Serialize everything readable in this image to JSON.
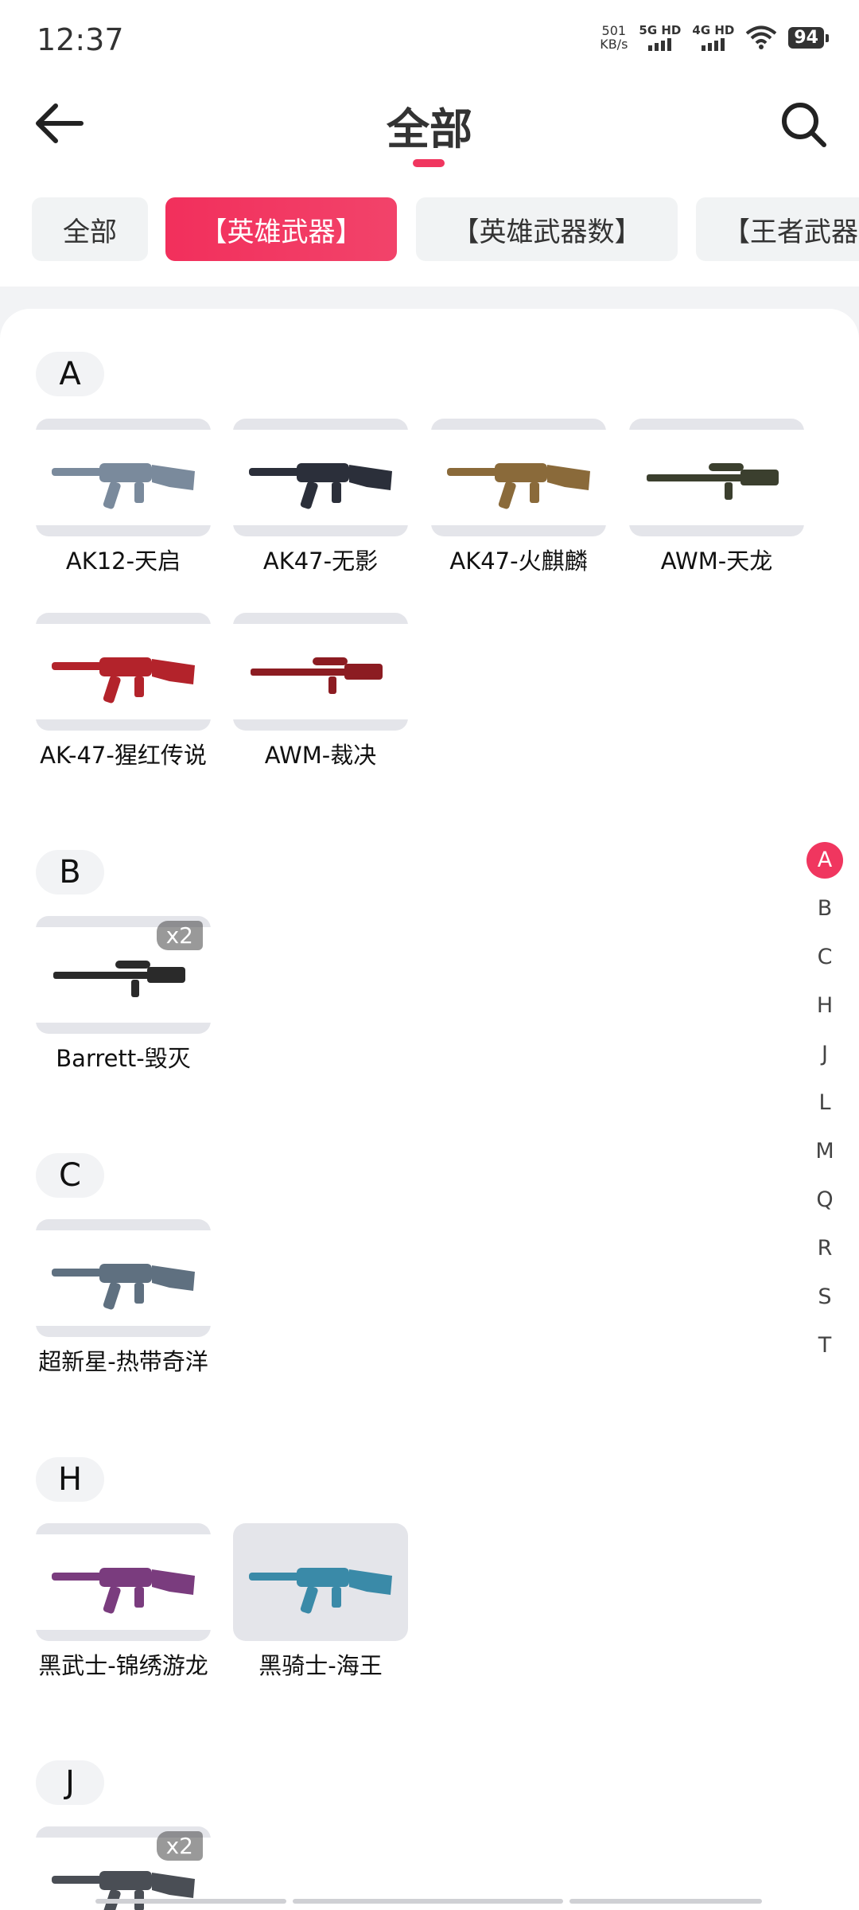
{
  "status_bar": {
    "time": "12:37",
    "net_speed_value": "501",
    "net_speed_unit": "KB/s",
    "sim1": "5G HD",
    "sim2": "4G HD",
    "battery": "94"
  },
  "header": {
    "title": "全部"
  },
  "filters": [
    {
      "label": "全部",
      "active": false
    },
    {
      "label": "【英雄武器】",
      "active": true
    },
    {
      "label": "【英雄武器数】",
      "active": false
    },
    {
      "label": "【王者武器",
      "active": false
    }
  ],
  "sections": [
    {
      "letter": "A",
      "items": [
        {
          "name": "AK12-天启",
          "color": "#7a8a9c"
        },
        {
          "name": "AK47-无影",
          "color": "#2b2f3a"
        },
        {
          "name": "AK47-火麒麟",
          "color": "#8a6a3a"
        },
        {
          "name": "AWM-天龙",
          "color": "#3b3f2e"
        },
        {
          "name": "AK-47-猩红传说",
          "color": "#b3232b"
        },
        {
          "name": "AWM-裁决",
          "color": "#8c1c22"
        }
      ]
    },
    {
      "letter": "B",
      "items": [
        {
          "name": "Barrett-毁灭",
          "color": "#2a2a2a",
          "badge": "x2"
        }
      ]
    },
    {
      "letter": "C",
      "items": [
        {
          "name": "超新星-热带奇洋",
          "color": "#5f7080"
        }
      ]
    },
    {
      "letter": "H",
      "items": [
        {
          "name": "黑武士-锦绣游龙",
          "color": "#7a3c7e"
        },
        {
          "name": "黑骑士-海王",
          "color": "#3a8aa8"
        }
      ]
    },
    {
      "letter": "J",
      "items": [
        {
          "name": "",
          "color": "#4a4e55",
          "badge": "x2"
        }
      ]
    }
  ],
  "index_bar": {
    "letters": [
      "A",
      "B",
      "C",
      "H",
      "J",
      "L",
      "M",
      "Q",
      "R",
      "S",
      "T"
    ],
    "active": "A",
    "accent_color": "#f0365f"
  },
  "icons": {
    "back": "arrow-left-icon",
    "search": "search-icon"
  }
}
